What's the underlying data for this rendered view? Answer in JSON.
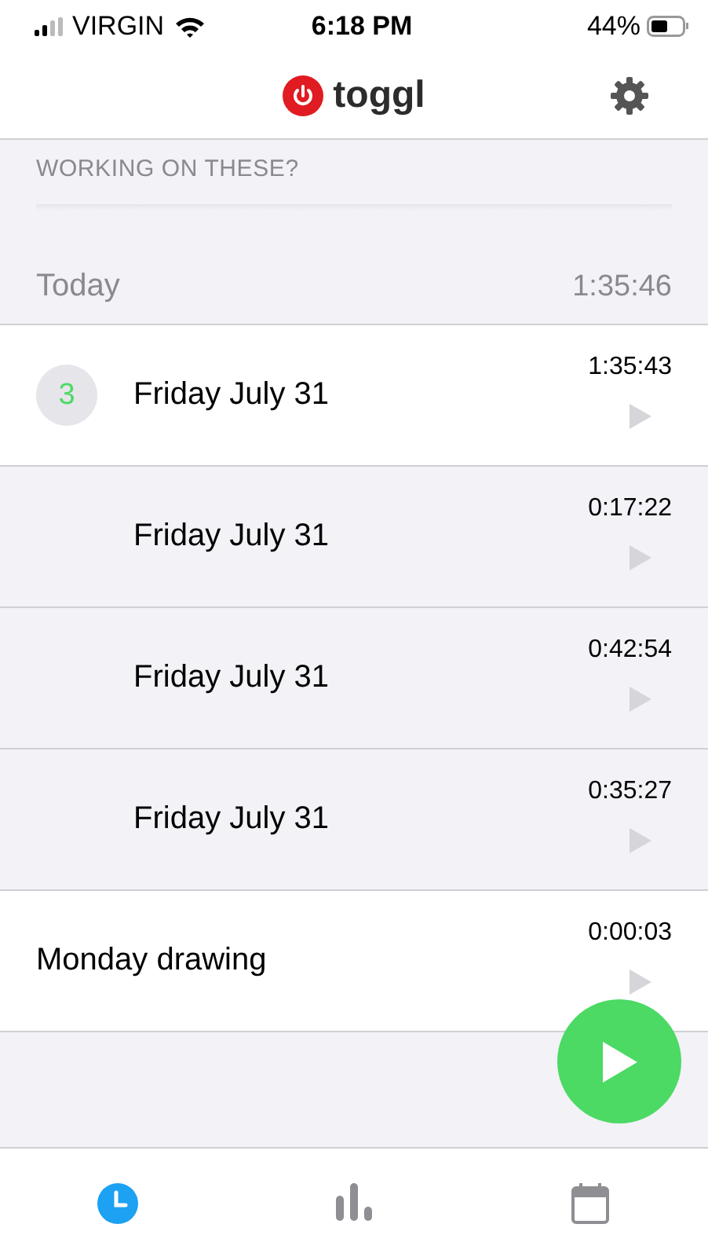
{
  "status_bar": {
    "carrier": "VIRGIN",
    "time": "6:18 PM",
    "battery": "44%"
  },
  "nav": {
    "logo": "toggl"
  },
  "suggestions": {
    "title": "WORKING ON THESE?"
  },
  "day": {
    "label": "Today",
    "total": "1:35:46"
  },
  "entries": [
    {
      "kind": "group",
      "count": "3",
      "description": "Friday July 31",
      "duration": "1:35:43"
    },
    {
      "kind": "child",
      "description": "Friday July 31",
      "duration": "0:17:22"
    },
    {
      "kind": "child",
      "description": "Friday July 31",
      "duration": "0:42:54"
    },
    {
      "kind": "child",
      "description": "Friday July 31",
      "duration": "0:35:27"
    },
    {
      "kind": "single",
      "description": "Monday drawing",
      "duration": "0:00:03"
    }
  ],
  "tabs": [
    {
      "kind": "timer",
      "selected": true
    },
    {
      "kind": "reports",
      "selected": false
    },
    {
      "kind": "calendar",
      "selected": false
    }
  ]
}
